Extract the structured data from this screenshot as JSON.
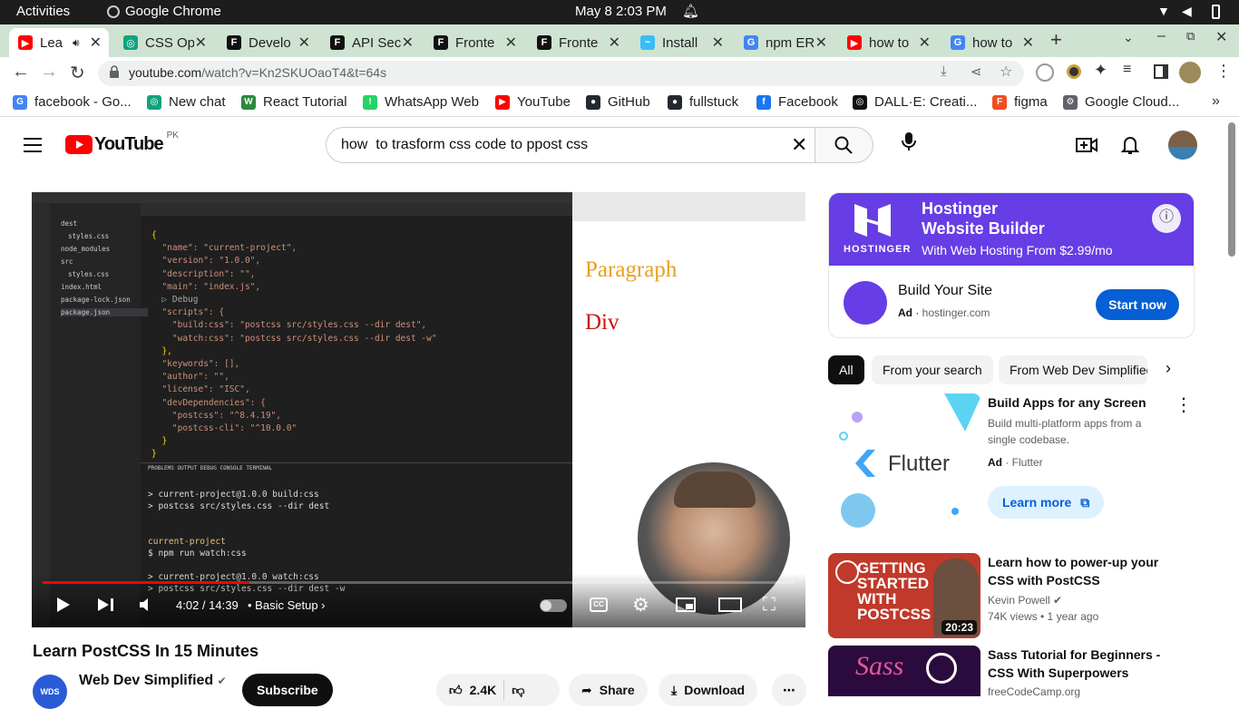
{
  "os": {
    "activities": "Activities",
    "app": "Google Chrome",
    "clock": "May 8   2:03 PM"
  },
  "tabs": [
    {
      "label": "Lea",
      "color": "#ff0000",
      "glyph": "▶"
    },
    {
      "label": "CSS Op",
      "color": "#10a37f",
      "glyph": "◎"
    },
    {
      "label": "Develo",
      "color": "#111111",
      "glyph": "F"
    },
    {
      "label": "API Sec",
      "color": "#111111",
      "glyph": "F"
    },
    {
      "label": "Fronte",
      "color": "#111111",
      "glyph": "F"
    },
    {
      "label": "Fronte",
      "color": "#111111",
      "glyph": "F"
    },
    {
      "label": "Install",
      "color": "#38bdf8",
      "glyph": "~"
    },
    {
      "label": "npm ER",
      "color": "#4285f4",
      "glyph": "G"
    },
    {
      "label": "how to",
      "color": "#ff0000",
      "glyph": "▶"
    },
    {
      "label": "how to",
      "color": "#4285f4",
      "glyph": "G"
    }
  ],
  "url": {
    "host": "youtube.com",
    "path": "/watch?v=Kn2SKUOaoT4&t=64s"
  },
  "bookmarks": [
    {
      "label": "facebook - Go...",
      "color": "#4285f4",
      "glyph": "G"
    },
    {
      "label": "New chat",
      "color": "#10a37f",
      "glyph": "◎"
    },
    {
      "label": "React Tutorial",
      "color": "#2b8a3e",
      "glyph": "W"
    },
    {
      "label": "WhatsApp Web",
      "color": "#25d366",
      "glyph": "!"
    },
    {
      "label": "YouTube",
      "color": "#ff0000",
      "glyph": "▶"
    },
    {
      "label": "GitHub",
      "color": "#24292f",
      "glyph": "●"
    },
    {
      "label": "fullstuck",
      "color": "#24292f",
      "glyph": "●"
    },
    {
      "label": "Facebook",
      "color": "#1877f2",
      "glyph": "f"
    },
    {
      "label": "DALL·E: Creati...",
      "color": "#111111",
      "glyph": "◎"
    },
    {
      "label": "figma",
      "color": "#f24e1e",
      "glyph": "F"
    },
    {
      "label": "Google Cloud...",
      "color": "#5f6368",
      "glyph": "⚙"
    }
  ],
  "yt": {
    "logo": "YouTube",
    "country": "PK",
    "search_query": "how  to trasform css code to ppost css"
  },
  "player": {
    "time": "4:02 / 14:39",
    "chapter": "Basic Setup",
    "progress_fraction": 0.275,
    "preview_paragraph": "Paragraph",
    "preview_div": "Div",
    "files": [
      "dest",
      "styles.css",
      "node_modules",
      "src",
      "styles.css",
      "index.html",
      "package-lock.json",
      "package.json"
    ],
    "code_lines": [
      "{",
      "  \"name\": \"current-project\",",
      "  \"version\": \"1.0.0\",",
      "  \"description\": \"\",",
      "  \"main\": \"index.js\",",
      "  ▷ Debug",
      "  \"scripts\": {",
      "    \"build:css\": \"postcss src/styles.css --dir dest\",",
      "    \"watch:css\": \"postcss src/styles.css --dir dest -w\"",
      "  },",
      "  \"keywords\": [],",
      "  \"author\": \"\",",
      "  \"license\": \"ISC\",",
      "  \"devDependencies\": {",
      "    \"postcss\": \"^8.4.19\",",
      "    \"postcss-cli\": \"^10.0.0\"",
      "  }",
      "}"
    ],
    "terminal_lines": [
      "> current-project@1.0.0 build:css",
      "> postcss src/styles.css --dir dest",
      "",
      "",
      "current-project",
      "$ npm run watch:css",
      "",
      "> current-project@1.0.0 watch:css",
      "> postcss src/styles.css --dir dest -w"
    ]
  },
  "ad": {
    "brand_line1": "Hostinger",
    "brand_line2": "Website Builder",
    "brand_sub": "With Web Hosting From $2.99/mo",
    "logo_text": "HOSTINGER",
    "title": "Build Your Site",
    "ad_label": "Ad",
    "domain": "hostinger.com",
    "cta": "Start now"
  },
  "chips": [
    "All",
    "From your search",
    "From Web Dev Simplified"
  ],
  "recs": [
    {
      "title": "Build Apps for any Screen",
      "desc": "Build multi-platform apps from a single codebase.",
      "ad": "Ad",
      "channel": "Flutter",
      "cta": "Learn more",
      "thumb_text": "Flutter"
    },
    {
      "title": "Learn how to power-up your CSS with PostCSS",
      "channel": "Kevin Powell",
      "meta": "74K views  •  1 year ago",
      "duration": "20:23",
      "thumb_text": "GETTING STARTED WITH POSTCSS"
    },
    {
      "title": "Sass Tutorial for Beginners - CSS With Superpowers",
      "channel": "freeCodeCamp.org",
      "thumb_text": "Sass"
    }
  ],
  "video": {
    "title": "Learn PostCSS In 15 Minutes",
    "channel": "Web Dev Simplified",
    "subscribe": "Subscribe",
    "likes": "2.4K",
    "share": "Share",
    "download": "Download"
  }
}
